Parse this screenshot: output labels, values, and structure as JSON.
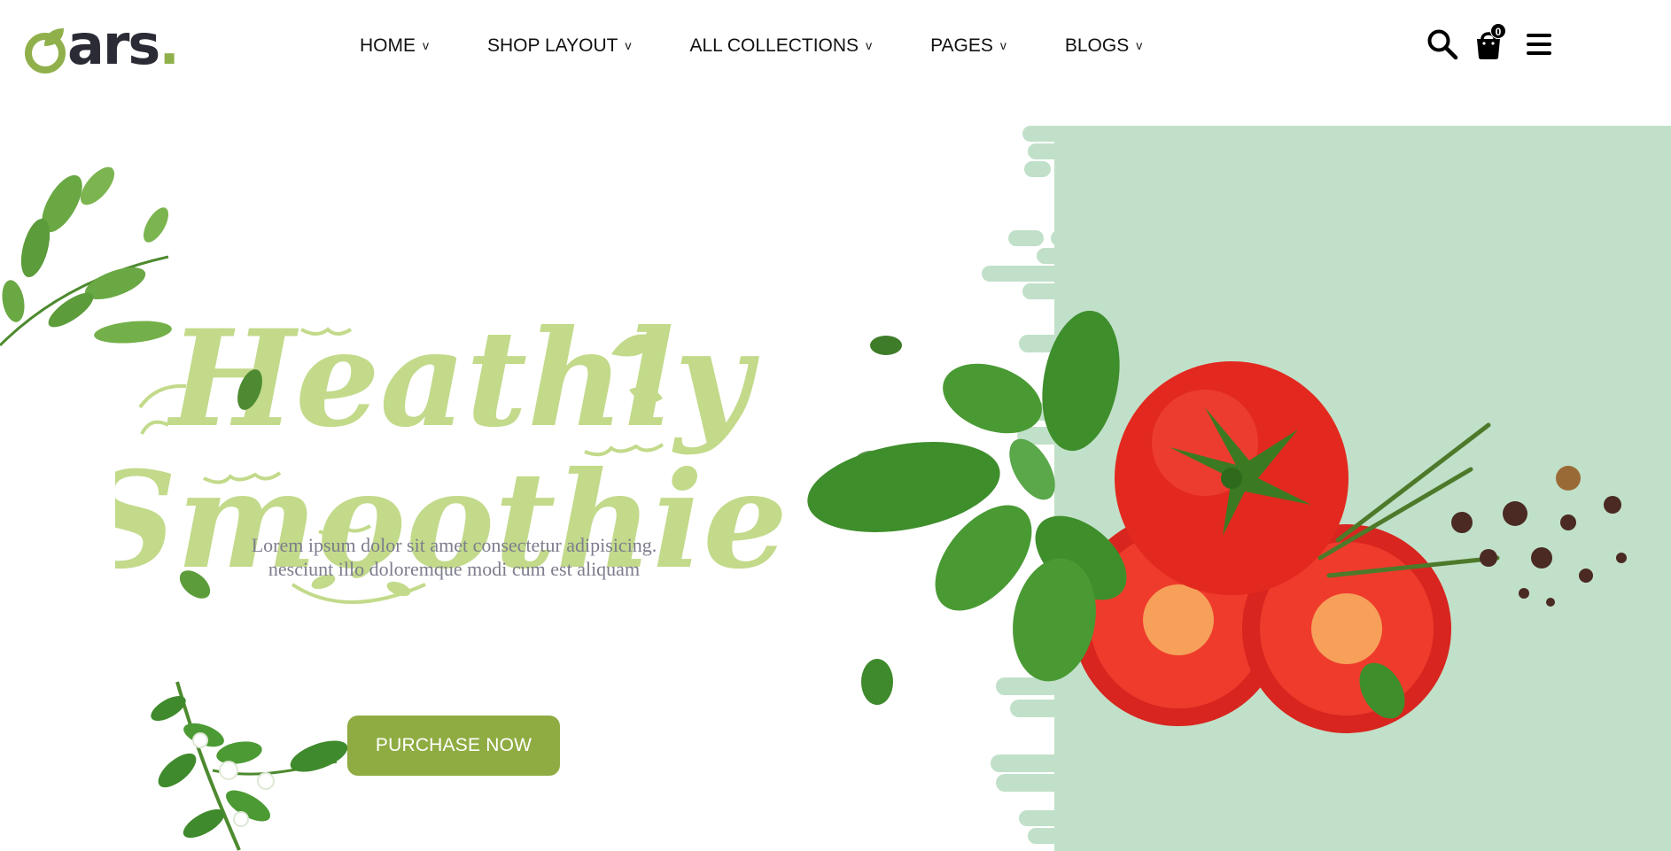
{
  "header": {
    "logo": {
      "text": "ars",
      "dot": "."
    },
    "nav": [
      {
        "label": "HOME",
        "chevron": "v"
      },
      {
        "label": "SHOP LAYOUT",
        "chevron": "v"
      },
      {
        "label": "ALL COLLECTIONS",
        "chevron": "v"
      },
      {
        "label": "PAGES",
        "chevron": "v"
      },
      {
        "label": "BLOGS",
        "chevron": "v"
      }
    ],
    "icons": {
      "search": "search-icon",
      "cart": "shopping-bag-icon",
      "menu": "hamburger-menu-icon"
    },
    "cart_count": "0"
  },
  "hero": {
    "title_line1": "Heathly",
    "title_line2": "Smoothie",
    "description_line1": "Lorem ipsum dolor sit amet consectetur adipisicing.",
    "description_line2": "nesciunt illo doloremque modi cum est aliquam",
    "button_label": "PURCHASE NOW"
  },
  "colors": {
    "brand_green": "#8fac42",
    "title_green": "#c2da8a",
    "panel_mint": "#c1e0c9",
    "text_gray": "#7d7d8d",
    "logo_dark": "#2b2b36"
  }
}
